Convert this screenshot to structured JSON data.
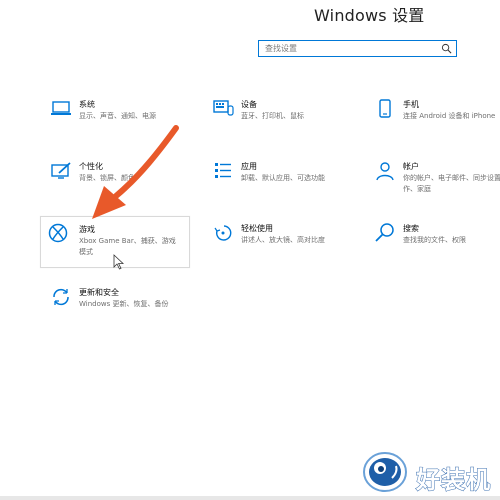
{
  "window": {
    "title": "Windows 设置"
  },
  "search": {
    "placeholder": "查找设置"
  },
  "tiles": [
    {
      "icon": "laptop-icon",
      "name": "系统",
      "desc": "显示、声音、通知、电源"
    },
    {
      "icon": "devices-icon",
      "name": "设备",
      "desc": "蓝牙、打印机、鼠标"
    },
    {
      "icon": "phone-icon",
      "name": "手机",
      "desc": "连接 Android 设备和 iPhone"
    },
    {
      "icon": "personalization-icon",
      "name": "个性化",
      "desc": "背景、锁屏、颜色"
    },
    {
      "icon": "apps-list-icon",
      "name": "应用",
      "desc": "卸载、默认应用、可选功能"
    },
    {
      "icon": "person-icon",
      "name": "帐户",
      "desc": "你的帐户、电子邮件、同步设置、工作、家庭"
    },
    {
      "icon": "xbox-icon",
      "name": "游戏",
      "desc": "Xbox Game Bar、捕获、游戏模式"
    },
    {
      "icon": "accessibility-icon",
      "name": "轻松使用",
      "desc": "讲述人、放大镜、高对比度"
    },
    {
      "icon": "search-magnifier-icon",
      "name": "搜索",
      "desc": "查找我的文件、权限"
    },
    {
      "icon": "update-sync-icon",
      "name": "更新和安全",
      "desc": "Windows 更新、恢复、备份"
    }
  ],
  "colors": {
    "accent": "#0078d7",
    "annotation_arrow": "#e8592a"
  },
  "watermark": {
    "text": "好装机"
  }
}
